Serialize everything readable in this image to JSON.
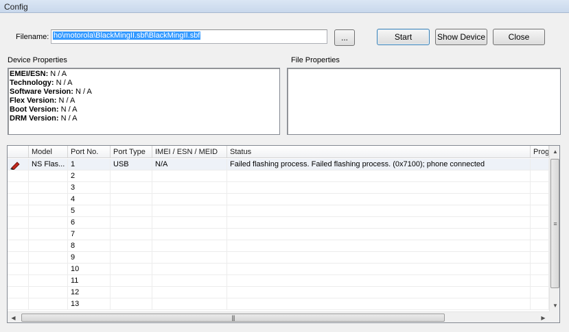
{
  "window": {
    "title": "Config"
  },
  "filename": {
    "label": "Filename:",
    "value": "ho\\motorola\\BlackMingII.sbf\\BlackMingII.sbf"
  },
  "buttons": {
    "browse": "...",
    "start": "Start",
    "show_device": "Show Device",
    "close": "Close"
  },
  "device_properties": {
    "label": "Device Properties",
    "items": [
      {
        "key": "EMEI/ESN:",
        "value": " N / A"
      },
      {
        "key": "Technology:",
        "value": " N / A"
      },
      {
        "key": "Software Version:",
        "value": " N / A"
      },
      {
        "key": "Flex Version:",
        "value": " N / A"
      },
      {
        "key": "Boot Version:",
        "value": " N / A"
      },
      {
        "key": "DRM Version:",
        "value": " N / A"
      }
    ]
  },
  "file_properties": {
    "label": "File Properties"
  },
  "grid": {
    "columns": [
      "",
      "Model",
      "Port No.",
      "Port Type",
      "IMEI / ESN / MEID",
      "Status",
      "Prog"
    ],
    "rows": [
      {
        "icon": "phone-icon",
        "model": "NS Flas...",
        "port": "1",
        "port_type": "USB",
        "imei": "N/A",
        "status": "Failed flashing process. Failed flashing process.  (0x7100); phone connected"
      },
      {
        "icon": "",
        "model": "",
        "port": "2",
        "port_type": "",
        "imei": "",
        "status": ""
      },
      {
        "icon": "",
        "model": "",
        "port": "3",
        "port_type": "",
        "imei": "",
        "status": ""
      },
      {
        "icon": "",
        "model": "",
        "port": "4",
        "port_type": "",
        "imei": "",
        "status": ""
      },
      {
        "icon": "",
        "model": "",
        "port": "5",
        "port_type": "",
        "imei": "",
        "status": ""
      },
      {
        "icon": "",
        "model": "",
        "port": "6",
        "port_type": "",
        "imei": "",
        "status": ""
      },
      {
        "icon": "",
        "model": "",
        "port": "7",
        "port_type": "",
        "imei": "",
        "status": ""
      },
      {
        "icon": "",
        "model": "",
        "port": "8",
        "port_type": "",
        "imei": "",
        "status": ""
      },
      {
        "icon": "",
        "model": "",
        "port": "9",
        "port_type": "",
        "imei": "",
        "status": ""
      },
      {
        "icon": "",
        "model": "",
        "port": "10",
        "port_type": "",
        "imei": "",
        "status": ""
      },
      {
        "icon": "",
        "model": "",
        "port": "11",
        "port_type": "",
        "imei": "",
        "status": ""
      },
      {
        "icon": "",
        "model": "",
        "port": "12",
        "port_type": "",
        "imei": "",
        "status": ""
      },
      {
        "icon": "",
        "model": "",
        "port": "13",
        "port_type": "",
        "imei": "",
        "status": ""
      }
    ]
  },
  "colors": {
    "selection": "#3399ff",
    "phone_icon": "#c0281e"
  }
}
